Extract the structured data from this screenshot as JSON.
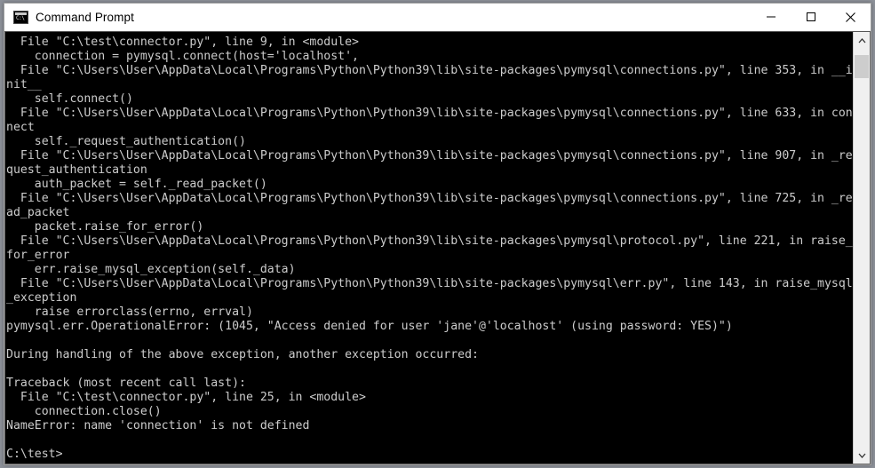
{
  "window": {
    "title": "Command Prompt",
    "icon": "console-icon",
    "background_color": "#000000",
    "text_color": "#cccccc",
    "controls": [
      {
        "name": "minimize",
        "glyph": "—"
      },
      {
        "name": "maximize",
        "glyph": "□"
      },
      {
        "name": "close",
        "glyph": "✕"
      }
    ]
  },
  "console": {
    "prompt": "C:\\test>",
    "lines": [
      "  File \"C:\\test\\connector.py\", line 9, in <module>",
      "    connection = pymysql.connect(host='localhost',",
      "  File \"C:\\Users\\User\\AppData\\Local\\Programs\\Python\\Python39\\lib\\site-packages\\pymysql\\connections.py\", line 353, in __init__",
      "    self.connect()",
      "  File \"C:\\Users\\User\\AppData\\Local\\Programs\\Python\\Python39\\lib\\site-packages\\pymysql\\connections.py\", line 633, in connect",
      "    self._request_authentication()",
      "  File \"C:\\Users\\User\\AppData\\Local\\Programs\\Python\\Python39\\lib\\site-packages\\pymysql\\connections.py\", line 907, in _request_authentication",
      "    auth_packet = self._read_packet()",
      "  File \"C:\\Users\\User\\AppData\\Local\\Programs\\Python\\Python39\\lib\\site-packages\\pymysql\\connections.py\", line 725, in _read_packet",
      "    packet.raise_for_error()",
      "  File \"C:\\Users\\User\\AppData\\Local\\Programs\\Python\\Python39\\lib\\site-packages\\pymysql\\protocol.py\", line 221, in raise_for_error",
      "    err.raise_mysql_exception(self._data)",
      "  File \"C:\\Users\\User\\AppData\\Local\\Programs\\Python\\Python39\\lib\\site-packages\\pymysql\\err.py\", line 143, in raise_mysql_exception",
      "    raise errorclass(errno, errval)",
      "pymysql.err.OperationalError: (1045, \"Access denied for user 'jane'@'localhost' (using password: YES)\")",
      "",
      "During handling of the above exception, another exception occurred:",
      "",
      "Traceback (most recent call last):",
      "  File \"C:\\test\\connector.py\", line 25, in <module>",
      "    connection.close()",
      "NameError: name 'connection' is not defined",
      "",
      "C:\\test>"
    ]
  },
  "scrollbar": {
    "up_arrow": "⌃",
    "down_arrow": "⌄",
    "thumb_position_percent": 2
  }
}
